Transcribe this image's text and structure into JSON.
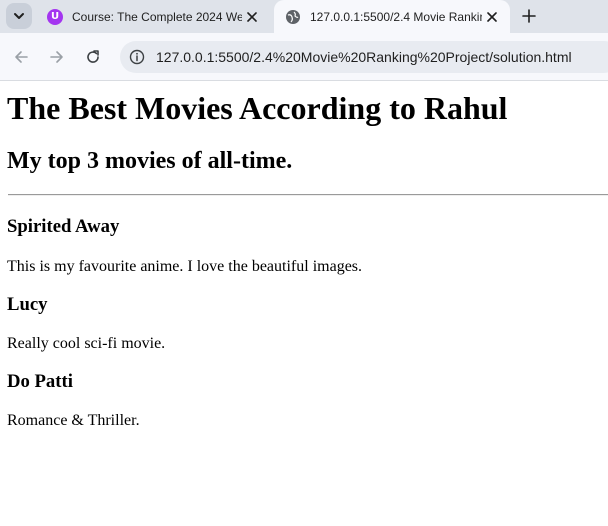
{
  "browser": {
    "tabs": [
      {
        "title": "Course: The Complete 2024 We",
        "favicon": "udemy-icon",
        "active": false
      },
      {
        "title": "127.0.0.1:5500/2.4 Movie Rankin",
        "favicon": "globe-icon",
        "active": true
      }
    ],
    "url": "127.0.0.1:5500/2.4%20Movie%20Ranking%20Project/solution.html"
  },
  "page": {
    "heading": "The Best Movies According to Rahul",
    "subheading": "My top 3 movies of all-time.",
    "movies": [
      {
        "title": "Spirited Away",
        "description": "This is my favourite anime. I love the beautiful images."
      },
      {
        "title": "Lucy",
        "description": "Really cool sci-fi movie."
      },
      {
        "title": "Do Patti",
        "description": "Romance & Thriller."
      }
    ]
  },
  "colors": {
    "tabstrip": "#dfe3ea",
    "toolbar": "#f7f8fc",
    "omnibox": "#e8ebf1",
    "udemy_purple": "#a435f0"
  }
}
